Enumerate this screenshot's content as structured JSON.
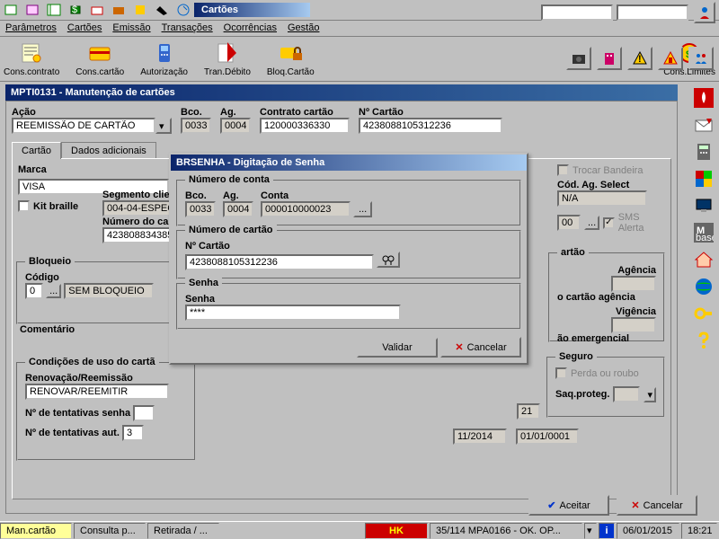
{
  "app_title": "Cartões",
  "menu": {
    "parametros": "Parâmetros",
    "cartoes": "Cartões",
    "emissao": "Emissão",
    "transacoes": "Transações",
    "ocorrencias": "Ocorrências",
    "gestao": "Gestão"
  },
  "big_toolbar": {
    "cons_contrato": "Cons.contrato",
    "cons_cartao": "Cons.cartão",
    "autorizacao": "Autorização",
    "tran_debito": "Tran.Débito",
    "bloq_cartao": "Bloq.Cartão",
    "cons_limites": "Cons.Limites"
  },
  "main_title": "MPTI0131 - Manutenção de cartões",
  "form": {
    "acao_label": "Ação",
    "acao_value": "REEMISSÃO DE CARTÃO",
    "bco_label": "Bco.",
    "bco": "0033",
    "ag_label": "Ag.",
    "ag": "0004",
    "contrato_label": "Contrato cartão",
    "contrato": "120000336330",
    "ncartao_label": "Nº Cartão",
    "ncartao": "4238088105312236"
  },
  "tabs": {
    "cartao": "Cartão",
    "dados": "Dados adicionais"
  },
  "cartao_tab": {
    "marca_label": "Marca",
    "marca": "VISA",
    "kit_label": "Kit braille",
    "segmento_label": "Segmento clie",
    "segmento": "004-04-ESPECIA",
    "numero_cartao_label": "Número do cart",
    "numero_cartao": "42380883438522",
    "bloqueio_label": "Bloqueio",
    "codigo_label": "Código",
    "codigo_num": "0",
    "codigo_txt": "SEM BLOQUEIO",
    "comentario_label": "Comentário",
    "condicoes_label": "Condições de uso do cartã",
    "renov_label": "Renovação/Reemissão",
    "renov": "RENOVAR/REEMITIR",
    "tent_senha_label": "Nº de tentativas senha",
    "tent_aut_label": "Nº de tentativas aut.",
    "tent_aut": "3",
    "trocar_bandeira_label": "Trocar Bandeira",
    "cod_ag_select_label": "Cód. Ag. Select",
    "cod_ag_select": "N/A",
    "sms_label": "SMS Alerta",
    "cartao_agencia_label": "o cartão agência",
    "emergencial_label": "ão emergencial",
    "agencia_label": "Agência",
    "vigencia_label": "Vigência",
    "seguro_label": "Seguro",
    "perda_label": "Perda ou roubo",
    "saq_label": "Saq.proteg.",
    "date1": "21",
    "date2": "11/2014",
    "date3": "01/01/0001",
    "sms_val": "00",
    "artao_label": "artão"
  },
  "dialog": {
    "title": "BRSENHA - Digitação de Senha",
    "num_conta_label": "Número de conta",
    "bco_label": "Bco.",
    "bco": "0033",
    "ag_label": "Ag.",
    "ag": "0004",
    "conta_label": "Conta",
    "conta": "000010000023",
    "num_cartao_label": "Número de cartão",
    "ncartao_label": "Nº Cartão",
    "ncartao": "4238088105312236",
    "senha_group": "Senha",
    "senha_label": "Senha",
    "senha": "****",
    "validar": "Validar",
    "cancelar": "Cancelar"
  },
  "buttons": {
    "aceitar": "Aceitar",
    "cancelar": "Cancelar"
  },
  "statusbar": {
    "tab1": "Man.cartão",
    "tab2": "Consulta p...",
    "tab3": "Retirada / ...",
    "hk": "HK",
    "info": "35/114 MPA0166 -  OK. OP...",
    "date": "06/01/2015",
    "time": "18:21"
  }
}
